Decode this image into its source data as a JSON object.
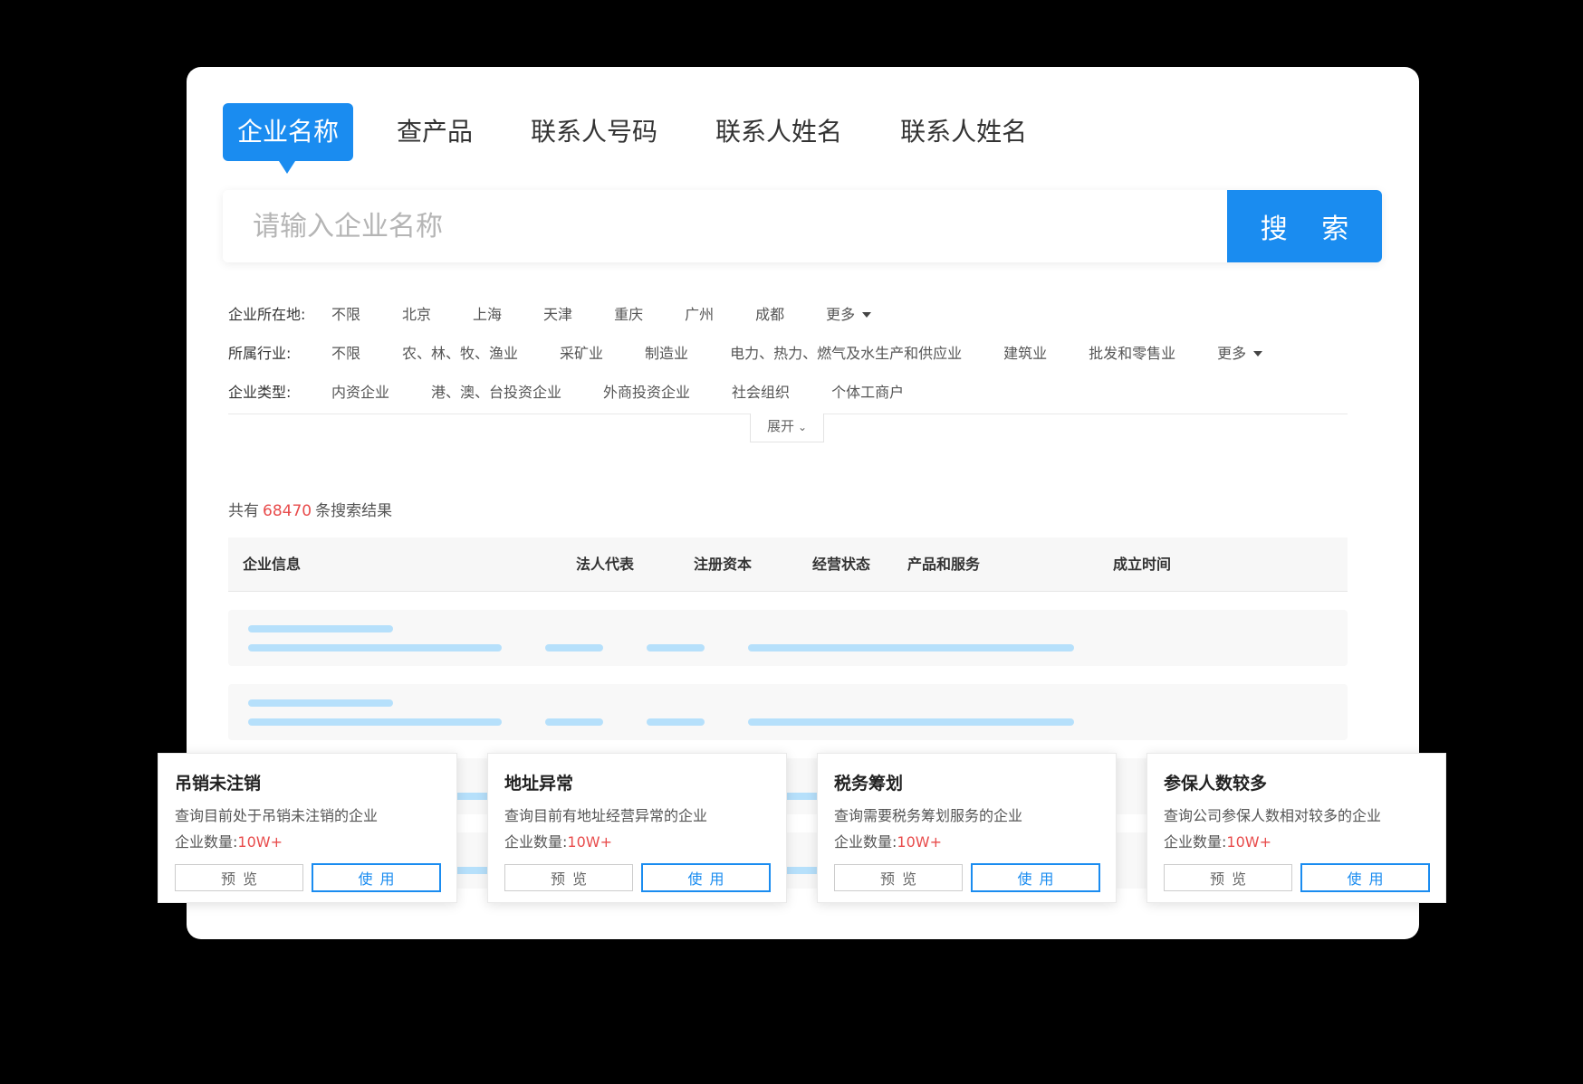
{
  "tabs": [
    {
      "label": "企业名称",
      "active": true
    },
    {
      "label": "查产品"
    },
    {
      "label": "联系人号码"
    },
    {
      "label": "联系人姓名"
    },
    {
      "label": "联系人姓名"
    }
  ],
  "search": {
    "placeholder": "请输入企业名称",
    "value": "",
    "button_label": "搜 索"
  },
  "filters": {
    "location": {
      "label": "企业所在地:",
      "options": [
        "不限",
        "北京",
        "上海",
        "天津",
        "重庆",
        "广州",
        "成都"
      ],
      "more": "更多"
    },
    "industry": {
      "label": "所属行业:",
      "options": [
        "不限",
        "农、林、牧、渔业",
        "采矿业",
        "制造业",
        "电力、热力、燃气及水生产和供应业",
        "建筑业",
        "批发和零售业"
      ],
      "more": "更多"
    },
    "type": {
      "label": "企业类型:",
      "options": [
        "内资企业",
        "港、澳、台投资企业",
        "外商投资企业",
        "社会组织",
        "个体工商户"
      ]
    },
    "expand_label": "展开"
  },
  "results": {
    "prefix": "共有",
    "count": "68470",
    "suffix": "条搜索结果"
  },
  "table": {
    "headers": [
      "企业信息",
      "法人代表",
      "注册资本",
      "经营状态",
      "产品和服务",
      "成立时间"
    ]
  },
  "template_cards": [
    {
      "title": "吊销未注销",
      "desc": "查询目前处于吊销未注销的企业",
      "count_label": "企业数量:",
      "count_value": "10W+",
      "preview": "预览",
      "use": "使用"
    },
    {
      "title": "地址异常",
      "desc": "查询目前有地址经营异常的企业",
      "count_label": "企业数量:",
      "count_value": "10W+",
      "preview": "预览",
      "use": "使用"
    },
    {
      "title": "税务筹划",
      "desc": "查询需要税务筹划服务的企业",
      "count_label": "企业数量:",
      "count_value": "10W+",
      "preview": "预览",
      "use": "使用"
    },
    {
      "title": "参保人数较多",
      "desc": "查询公司参保人数相对较多的企业",
      "count_label": "企业数量:",
      "count_value": "10W+",
      "preview": "预览",
      "use": "使用"
    }
  ],
  "colors": {
    "accent": "#1a8cf0",
    "highlight": "#e84c4c",
    "skeleton": "#b6e0fb"
  }
}
